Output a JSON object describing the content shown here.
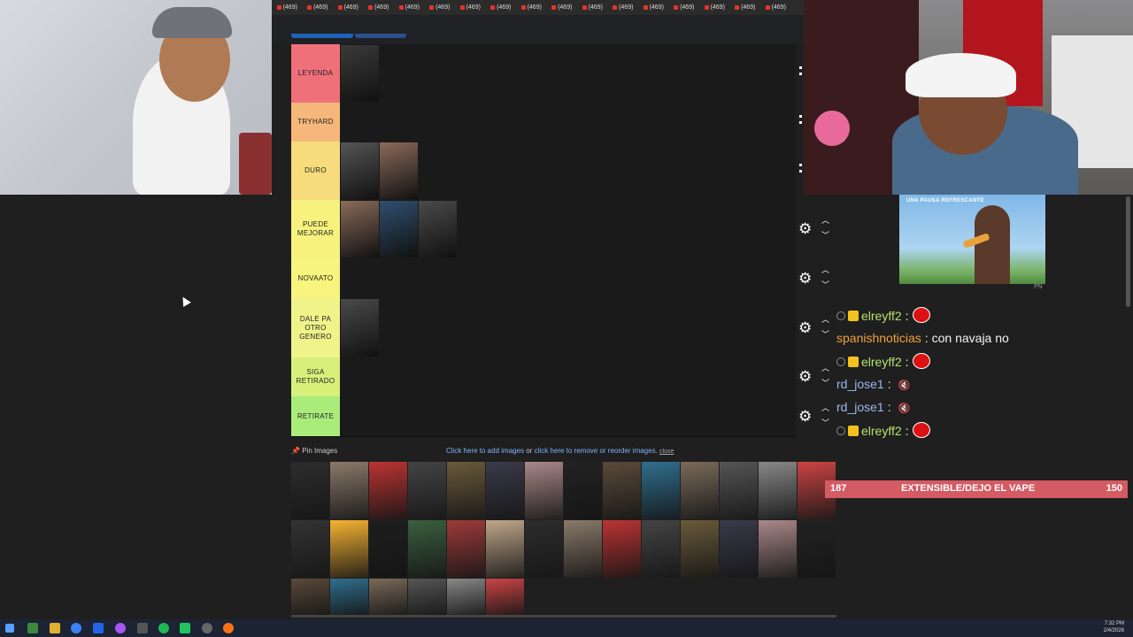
{
  "browser": {
    "tab_label": "(469)",
    "tab_count": 17
  },
  "tiers": [
    {
      "label": "LEYENDA",
      "color": "#f0707a",
      "images": 1
    },
    {
      "label": "TRYHARD",
      "color": "#f6b87a",
      "images": 0
    },
    {
      "label": "DURO",
      "color": "#f7dc7d",
      "images": 2
    },
    {
      "label": "PUEDE MEJORAR",
      "color": "#f7f27d",
      "images": 3
    },
    {
      "label": "NOVAATO",
      "color": "#f8f57e",
      "images": 0
    },
    {
      "label": "DALE PA OTRO GENERO",
      "color": "#f0f38a",
      "images": 1
    },
    {
      "label": "SIGA RETIRADO",
      "color": "#d8f07a",
      "images": 0
    },
    {
      "label": "RETIRATE",
      "color": "#a9ec7a",
      "images": 0
    }
  ],
  "pin": {
    "label": "Pin Images",
    "link_add": "Click here to add images",
    "link_or": "or",
    "link_remove": "click here to remove or reorder images.",
    "link_close": "close"
  },
  "chat": {
    "ad_text": "UNA PAUSA REFRESCANTE",
    "ad_tag": "PN",
    "messages": [
      {
        "user": "elreyff2",
        "sep": ":",
        "text": "",
        "type": "green"
      },
      {
        "user": "spanishnoticias",
        "sep": ":",
        "text": "con navaja no",
        "type": "orange"
      },
      {
        "user": "elreyff2",
        "sep": ":",
        "text": "",
        "type": "green"
      },
      {
        "user": "rd_jose1",
        "sep": ":",
        "text": "",
        "type": "blue"
      },
      {
        "user": "rd_jose1",
        "sep": ":",
        "text": "",
        "type": "blue"
      },
      {
        "user": "elreyff2",
        "sep": ":",
        "text": "",
        "type": "green"
      }
    ]
  },
  "goal": {
    "left": "187",
    "title": "EXTENSIBLE/DEJO EL VAPE",
    "right": "150",
    "progress_pct": 100
  },
  "clock": {
    "time": "7:32 PM",
    "date": "2/4/2026"
  },
  "colors": {
    "goal": "#d45a63",
    "green_user": "#b6e36c",
    "orange_user": "#f0a33a",
    "blue_user": "#9bb8f0"
  }
}
